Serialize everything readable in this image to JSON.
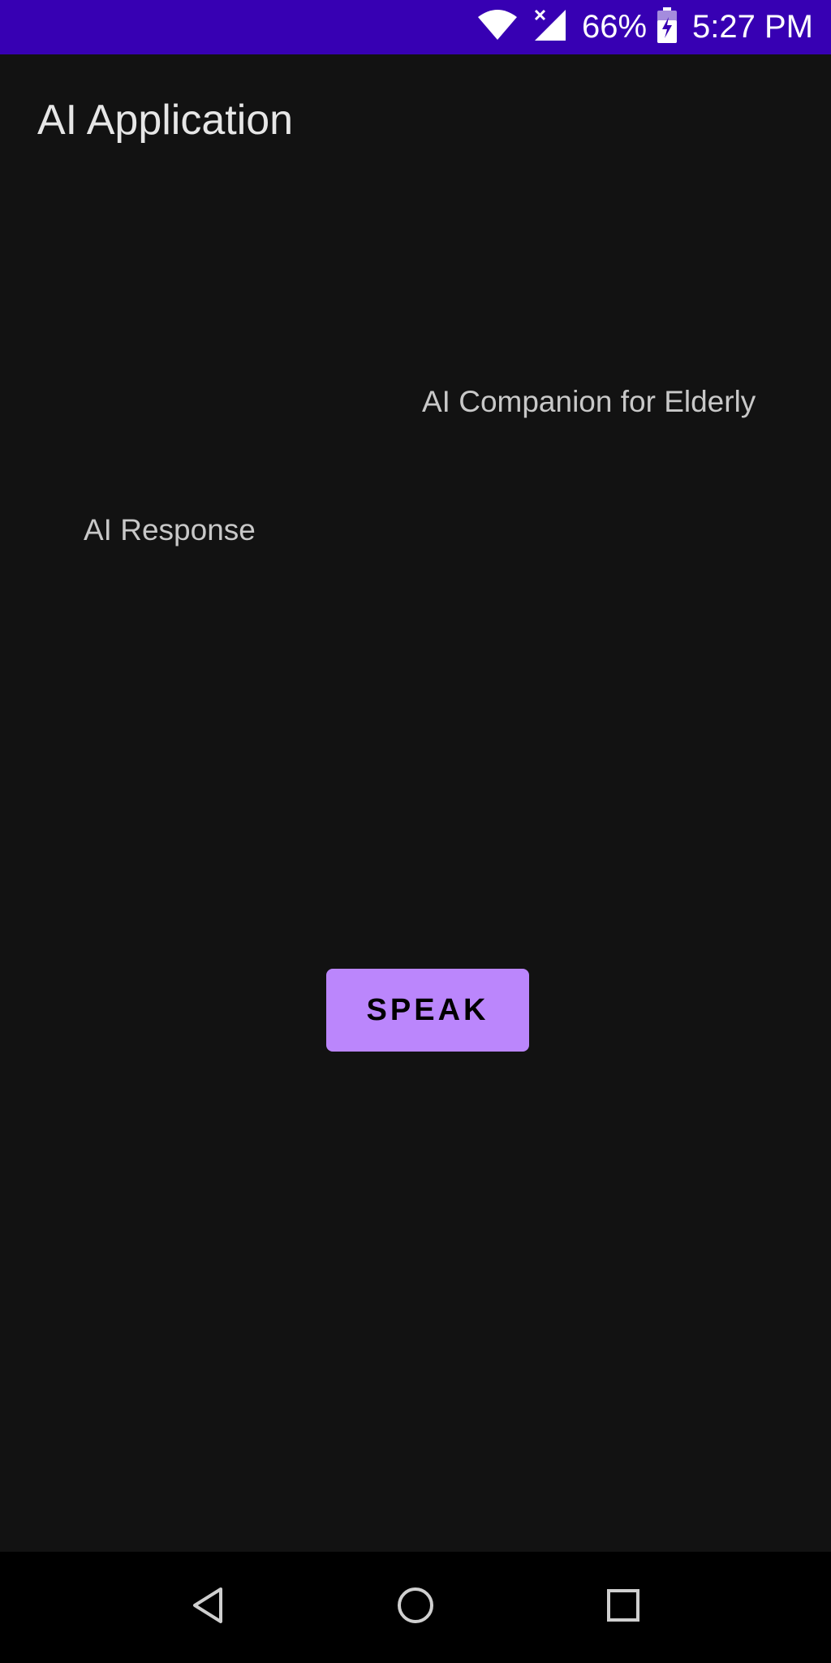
{
  "status_bar": {
    "battery_percent": "66%",
    "time": "5:27 PM",
    "icons": [
      "wifi-icon",
      "cell-signal-no-service-icon",
      "battery-charging-icon"
    ],
    "background_color": "#3700b3"
  },
  "app_bar": {
    "title": "AI Application"
  },
  "main": {
    "companion_label": "AI Companion for Elderly",
    "response_label": "AI Response",
    "speak_button_label": "SPEAK",
    "accent_color": "#bb86fc",
    "background_color": "#121212"
  },
  "nav_bar": {
    "buttons": [
      "back-icon",
      "home-icon",
      "recents-icon"
    ]
  }
}
